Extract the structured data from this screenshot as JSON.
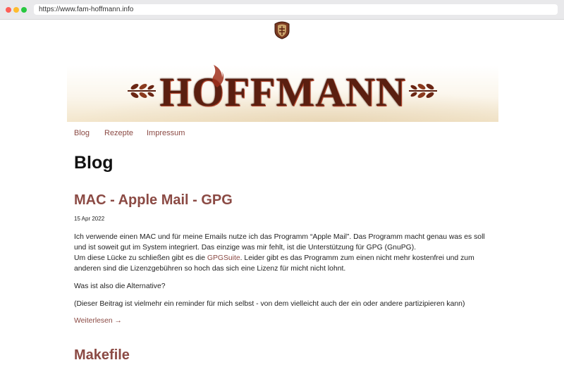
{
  "browser": {
    "url": "https://www.fam-hoffmann.info"
  },
  "header": {
    "logo_text": "HOFFMANN",
    "crest_icon": "coat-of-arms-icon",
    "laurel_icon": "laurel-branch-icon"
  },
  "nav": {
    "items": [
      {
        "label": "Blog"
      },
      {
        "label": "Rezepte"
      },
      {
        "label": "Impressum"
      }
    ]
  },
  "page": {
    "title": "Blog"
  },
  "posts": [
    {
      "title": "MAC - Apple Mail - GPG",
      "date": "15 Apr 2022",
      "p1_line1": "Ich verwende einen MAC und für meine Emails nutze ich das Programm “Apple Mail”. Das Programm macht genau was es soll und ist soweit gut im System integriert. Das einzige was mir fehlt, ist die Unterstützung für GPG (GnuPG).",
      "p1_line2_a": "Um diese Lücke zu schließen gibt es die ",
      "p1_link": "GPGSuite",
      "p1_line2_b": ". Leider gibt es das Programm zum einen nicht mehr kostenfrei und zum anderen sind die Lizenzgebühren so hoch das sich eine Lizenz für micht nicht lohnt.",
      "p2": "Was ist also die Alternative?",
      "p3": "(Dieser Beitrag ist vielmehr ein reminder für mich selbst - von dem vielleicht auch der ein oder andere partizipieren kann)",
      "read_more": "Weiterlesen →"
    },
    {
      "title": "Makefile"
    }
  ],
  "colors": {
    "accent": "#8b4a44",
    "logo": "#5a1f10"
  }
}
